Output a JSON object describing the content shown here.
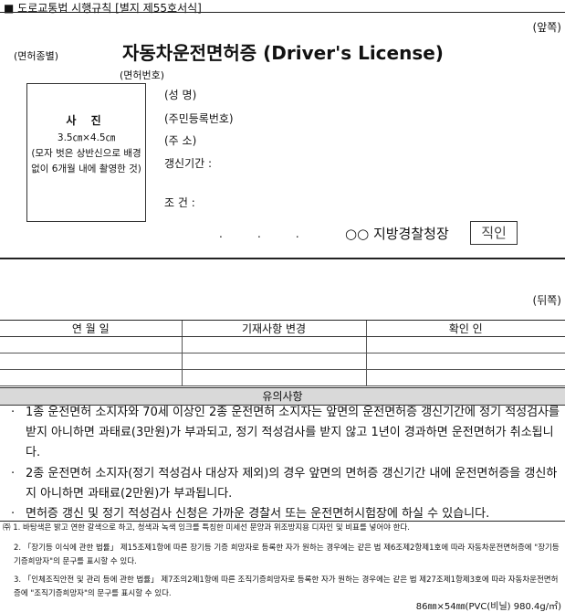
{
  "header": {
    "marker": "■",
    "form_ref": "도로교통법 시행규칙 [별지 제55호서식]"
  },
  "front": {
    "side_label": "(앞쪽)",
    "license_type_label": "(면허종별)",
    "title": "자동차운전면허증 (Driver's License)",
    "license_no_label": "(면허번호)",
    "photo": {
      "title": "사 진",
      "size": "3.5㎝×4.5㎝",
      "desc": "(모자 벗은 상반신으로 배경 없이 6개월 내에 촬영한 것)"
    },
    "fields": {
      "name": "(성 명)",
      "resident_no": "(주민등록번호)",
      "address": "(주 소)",
      "renewal": "갱신기간 :",
      "condition": "조 건 :"
    },
    "date_dots": ".          .          .",
    "issuer": "○○ 지방경찰청장",
    "seal": "직인"
  },
  "back": {
    "side_label": "(뒤쪽)",
    "columns": [
      "연 월 일",
      "기재사항 변경",
      "확인 인"
    ],
    "empty_rows": 3,
    "caution_title": "유의사항",
    "cautions": [
      "1종 운전면허 소지자와 70세 이상인 2종 운전면허 소지자는 앞면의 운전면허증 갱신기간에 정기 적성검사를 받지 아니하면 과태료(3만원)가 부과되고, 정기 적성검사를 받지 않고 1년이 경과하면 운전면허가 취소됩니다.",
      "2종 운전면허 소지자(정기 적성검사 대상자 제외)의 경우 앞면의 면허증 갱신기간 내에 운전면허증을 갱신하지 아니하면 과태료(2만원)가 부과됩니다.",
      "면허증 갱신 및 정기 적성검사 신청은 가까운 경찰서 또는 운전면허시험장에 하실 수 있습니다."
    ],
    "bullet": "·"
  },
  "footnotes": [
    "㈜ 1. 바탕색은 밝고 연한 갈색으로 하고, 청색과 녹색 잉크를 특칭한 미세선 문양과 위조방지용 디자인 및 비표를 넣어야 한다.",
    "2. 「장기등 이식에 관한 법률」 제15조제1항에 따른 장기등 기증 희망자로 등록한 자가 원하는 경우에는 같은 법 제6조제2항제1호에 따라 자동차운전면허증에 \"장기등기증희망자\"의 문구를 표시할 수 있다.",
    "3. 「인체조직안전 및 관리 등에 관한 법률」 제7조의2제1항에 따른 조직기증희망자로 등록한 자가 원하는 경우에는 같은 법 제27조제1항제3호에 따라 자동차운전면허증에 \"조직기증희망자\"의 문구를 표시할 수 있다."
  ],
  "spec": "86㎜×54㎜(PVC(비닐) 980.4g/㎡)"
}
